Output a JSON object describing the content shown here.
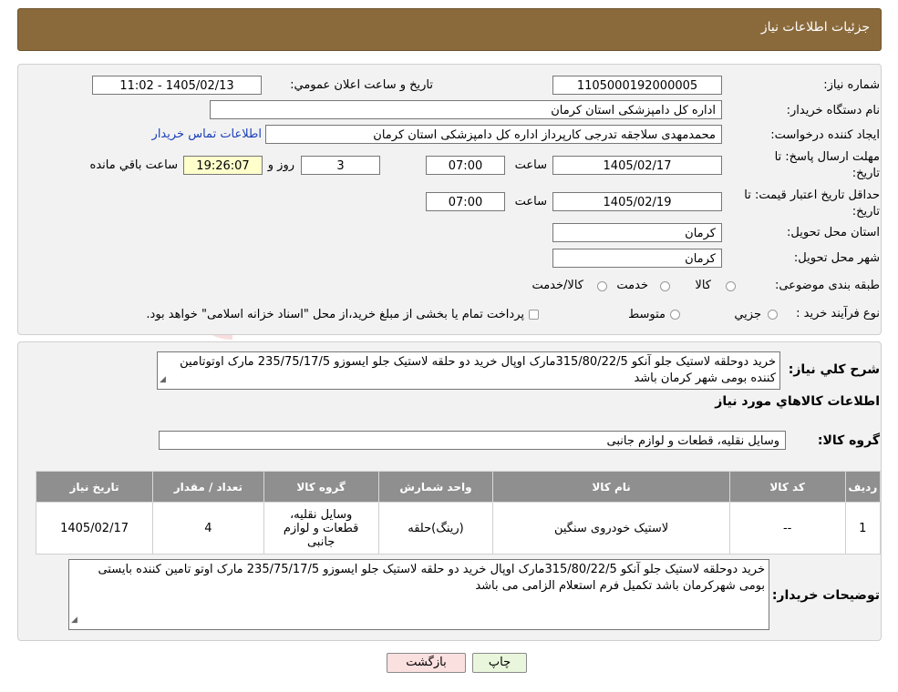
{
  "header": {
    "title": "جزئیات اطلاعات نیاز"
  },
  "info": {
    "need_number_label": "شماره نیاز:",
    "need_number": "1105000192000005",
    "announce_label": "تاریخ و ساعت اعلان عمومي:",
    "announce_value": "1405/02/13 - 11:02",
    "buyer_org_label": "نام دستگاه خريدار:",
    "buyer_org": "اداره کل دامپزشکی استان کرمان",
    "creator_label": "ايجاد کننده درخواست:",
    "creator": "محمدمهدی سلاجقه تدرجی کارپرداز اداره کل دامپزشکی استان کرمان",
    "contact_link": "اطلاعات تماس خريدار",
    "deadline_label_1": "مهلت ارسال پاسخ: تا",
    "deadline_label_2": "تاريخ:",
    "deadline_date": "1405/02/17",
    "time_label": "ساعت",
    "deadline_time": "07:00",
    "days_value": "3",
    "days_label": "روز و",
    "remaining_time": "19:26:07",
    "remaining_label": "ساعت باقي مانده",
    "validity_label_1": "حداقل تاريخ اعتبار قيمت: تا",
    "validity_label_2": "تاريخ:",
    "validity_date": "1405/02/19",
    "validity_time": "07:00",
    "province_label": "استان محل تحويل:",
    "province": "کرمان",
    "city_label": "شهر محل تحويل:",
    "city": "کرمان",
    "category_label": "طبقه بندی موضوعی:",
    "category_options": [
      "کالا",
      "خدمت",
      "کالا/خدمت"
    ],
    "process_label": "نوع فرآيند خريد :",
    "process_options": [
      "جزيي",
      "متوسط"
    ],
    "process_note": "پرداخت تمام يا بخشی از مبلغ خريد،از محل \"اسناد خزانه اسلامی\" خواهد بود."
  },
  "summary": {
    "label": "شرح کلي نياز:",
    "text": "خريد دوحلقه لاستيک جلو آنکو 315/80/22/5مارک اوپال خريد دو حلقه لاستيک جلو ايسوزو 235/75/17/5 مارک اوتوتامين کننده بومی شهر کرمان باشد",
    "goods_info_title": "اطلاعات کالاهاي مورد نياز",
    "goods_group_label": "گروه کالا:",
    "goods_group": "وسايل نقليه، قطعات و لوازم جانبی"
  },
  "table": {
    "headers": [
      "رديف",
      "کد کالا",
      "نام کالا",
      "واحد شمارش",
      "گروه کالا",
      "تعداد / مقدار",
      "تاريخ نياز"
    ],
    "rows": [
      [
        "1",
        "--",
        "لاستيک خودروی سنگين",
        "(رينگ)حلقه",
        "وسايل نقليه، قطعات و لوازم جانبی",
        "4",
        "1405/02/17"
      ]
    ]
  },
  "buyer_notes": {
    "label": "توضيحات خريدار:",
    "text": "خريد دوحلقه لاستيک جلو آنکو 315/80/22/5مارک اوپال خريد دو حلقه لاستيک جلو ايسوزو 235/75/17/5 مارک اوتو تامين کننده بايستی بومی شهرکرمان باشد تکميل فرم استعلام الزامی می باشد"
  },
  "buttons": {
    "print": "چاپ",
    "back": "بازگشت"
  },
  "colors": {
    "header": "#8a6a3b",
    "table_header": "#8f8f8f",
    "link": "#1a3fb8"
  }
}
